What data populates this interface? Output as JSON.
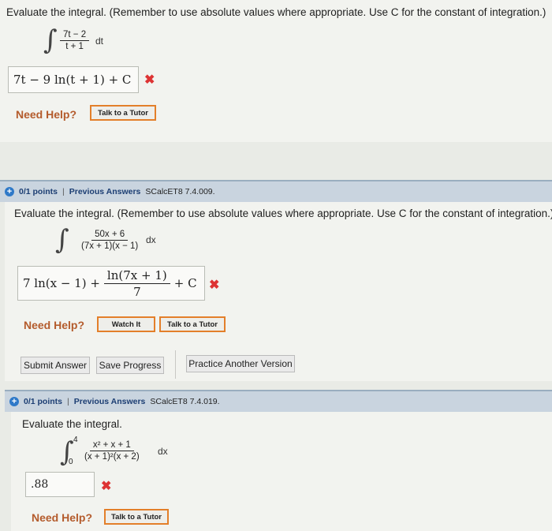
{
  "q1": {
    "prompt": "Evaluate the integral. (Remember to use absolute values where appropriate. Use C for the constant of integration.)",
    "integrand_num": "7t − 2",
    "integrand_den": "t + 1",
    "differential": "dt",
    "answer": "7t − 9 ln(t + 1) + C",
    "need_help": "Need Help?",
    "tutor_label": "Talk to a Tutor"
  },
  "q2": {
    "score": "0/1 points",
    "separator": "|",
    "previous_answers": "Previous Answers",
    "code": "SCalcET8 7.4.009.",
    "prompt": "Evaluate the integral. (Remember to use absolute values where appropriate. Use C for the constant of integration.)",
    "integrand_num": "50x + 6",
    "integrand_den": "(7x + 1)(x − 1)",
    "differential": "dx",
    "answer_prefix": "7 ln(x − 1) +",
    "answer_frac_num": "ln(7x + 1)",
    "answer_frac_den": "7",
    "answer_suffix": "+ C",
    "need_help": "Need Help?",
    "watch_label": "Watch It",
    "tutor_label": "Talk to a Tutor",
    "submit_label": "Submit Answer",
    "save_label": "Save Progress",
    "practice_label": "Practice Another Version"
  },
  "q3": {
    "score": "0/1 points",
    "separator": "|",
    "previous_answers": "Previous Answers",
    "code": "SCalcET8 7.4.019.",
    "prompt": "Evaluate the integral.",
    "upper_limit": "4",
    "lower_limit": "0",
    "integrand_num": "x² + x + 1",
    "integrand_den": "(x + 1)²(x + 2)",
    "differential": "dx",
    "answer": ".88",
    "need_help": "Need Help?",
    "tutor_label": "Talk to a Tutor"
  }
}
